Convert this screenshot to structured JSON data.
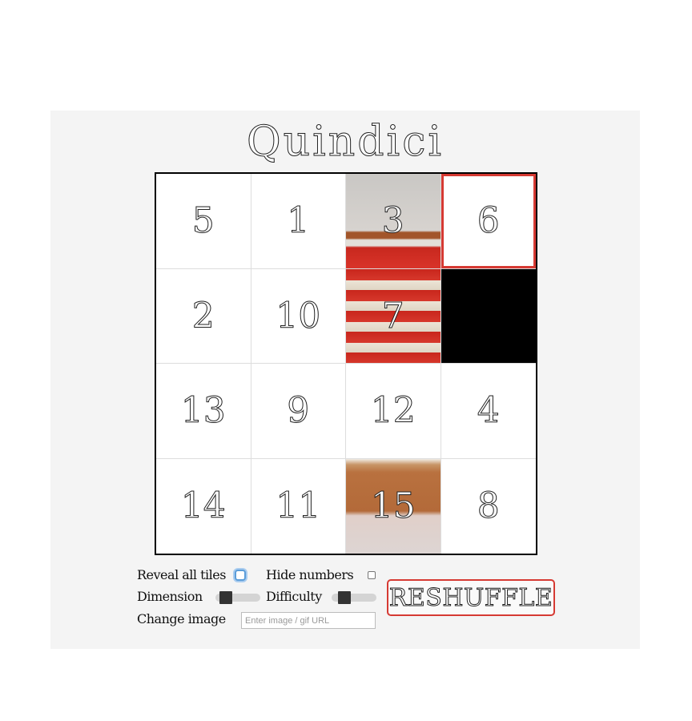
{
  "app": {
    "title": "Quindici"
  },
  "board": {
    "size": 4,
    "selected_tile": 6,
    "tiles": [
      {
        "number": "5",
        "revealed": false
      },
      {
        "number": "1",
        "revealed": false
      },
      {
        "number": "3",
        "revealed": true
      },
      {
        "number": "6",
        "revealed": false,
        "selected": true
      },
      {
        "number": "2",
        "revealed": false
      },
      {
        "number": "10",
        "revealed": false
      },
      {
        "number": "7",
        "revealed": true
      },
      {
        "number": "",
        "empty": true
      },
      {
        "number": "13",
        "revealed": false
      },
      {
        "number": "9",
        "revealed": false
      },
      {
        "number": "12",
        "revealed": false
      },
      {
        "number": "4",
        "revealed": false
      },
      {
        "number": "14",
        "revealed": false
      },
      {
        "number": "11",
        "revealed": false
      },
      {
        "number": "15",
        "revealed": true
      },
      {
        "number": "8",
        "revealed": false
      }
    ]
  },
  "controls": {
    "reveal_all_label": "Reveal all tiles",
    "reveal_all_checked": false,
    "hide_numbers_label": "Hide numbers",
    "hide_numbers_checked": false,
    "dimension_label": "Dimension",
    "dimension_level": 0.0,
    "difficulty_label": "Difficulty",
    "difficulty_level": 0.0,
    "change_image_label": "Change image",
    "image_url_value": "",
    "image_url_placeholder": "Enter image / gif URL",
    "reshuffle_label": "RESHUFFLE"
  },
  "colors": {
    "accent": "#d63a33",
    "empty_tile": "#000000",
    "panel_bg": "#f4f4f4"
  }
}
